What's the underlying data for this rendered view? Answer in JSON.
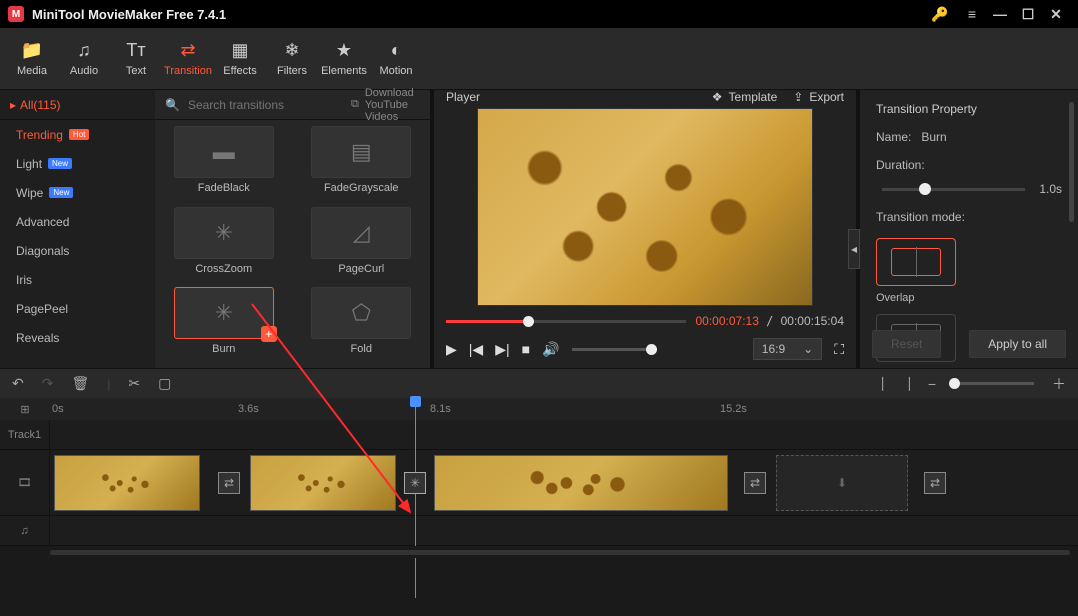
{
  "app": {
    "title": "MiniTool MovieMaker Free 7.4.1"
  },
  "toptabs": [
    {
      "label": "Media",
      "icon": "📁"
    },
    {
      "label": "Audio",
      "icon": "♫"
    },
    {
      "label": "Text",
      "icon": "Tᴛ"
    },
    {
      "label": "Transition",
      "icon": "⇄"
    },
    {
      "label": "Effects",
      "icon": "▦"
    },
    {
      "label": "Filters",
      "icon": "❄"
    },
    {
      "label": "Elements",
      "icon": "★"
    },
    {
      "label": "Motion",
      "icon": "◐"
    }
  ],
  "player": {
    "label": "Player",
    "template": "Template",
    "export": "Export",
    "current": "00:00:07:13",
    "total": "00:00:15:04",
    "aspect": "16:9"
  },
  "sidebar": {
    "all": "All(115)",
    "items": [
      {
        "label": "Trending",
        "badge": "Hot",
        "badgeClass": "hot"
      },
      {
        "label": "Light",
        "badge": "New",
        "badgeClass": "new"
      },
      {
        "label": "Wipe",
        "badge": "New",
        "badgeClass": "new"
      },
      {
        "label": "Advanced"
      },
      {
        "label": "Diagonals"
      },
      {
        "label": "Iris"
      },
      {
        "label": "PagePeel"
      },
      {
        "label": "Reveals"
      }
    ]
  },
  "search": {
    "placeholder": "Search transitions",
    "download": "Download YouTube Videos"
  },
  "transitions": [
    {
      "label": "FadeBlack"
    },
    {
      "label": "FadeGrayscale"
    },
    {
      "label": "CrossZoom"
    },
    {
      "label": "PageCurl"
    },
    {
      "label": "Burn"
    },
    {
      "label": "Fold"
    }
  ],
  "prop": {
    "title": "Transition Property",
    "name_label": "Name:",
    "name_value": "Burn",
    "duration_label": "Duration:",
    "duration_value": "1.0s",
    "mode_label": "Transition mode:",
    "mode_overlap": "Overlap",
    "reset": "Reset",
    "apply": "Apply to all"
  },
  "timeline": {
    "track": "Track1",
    "marks": [
      "0s",
      "3.6s",
      "8.1s",
      "15.2s"
    ]
  }
}
